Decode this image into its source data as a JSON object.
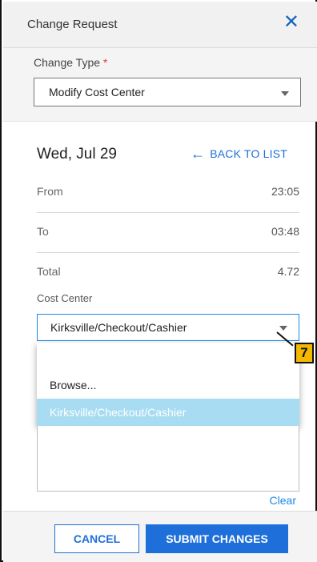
{
  "header": {
    "title": "Change Request",
    "close_icon": "close-icon"
  },
  "change_type": {
    "label": "Change Type",
    "required_mark": "*",
    "value": "Modify Cost Center"
  },
  "detail": {
    "date": "Wed, Jul 29",
    "back_label": "BACK TO LIST",
    "rows": [
      {
        "label": "From",
        "value": "23:05"
      },
      {
        "label": "To",
        "value": "03:48"
      },
      {
        "label": "Total",
        "value": "4.72"
      }
    ]
  },
  "cost_center": {
    "label": "Cost Center",
    "value": "Kirksville/Checkout/Cashier",
    "options": [
      "Browse...",
      "Kirksville/Checkout/Cashier"
    ],
    "clear_label": "Clear"
  },
  "annotation": {
    "number": "7",
    "color": "#f5b800"
  },
  "footer": {
    "cancel_label": "CANCEL",
    "submit_label": "SUBMIT CHANGES"
  },
  "colors": {
    "accent": "#1e6fd9",
    "selected_option": "#a8dcf3",
    "required": "#e53935"
  }
}
